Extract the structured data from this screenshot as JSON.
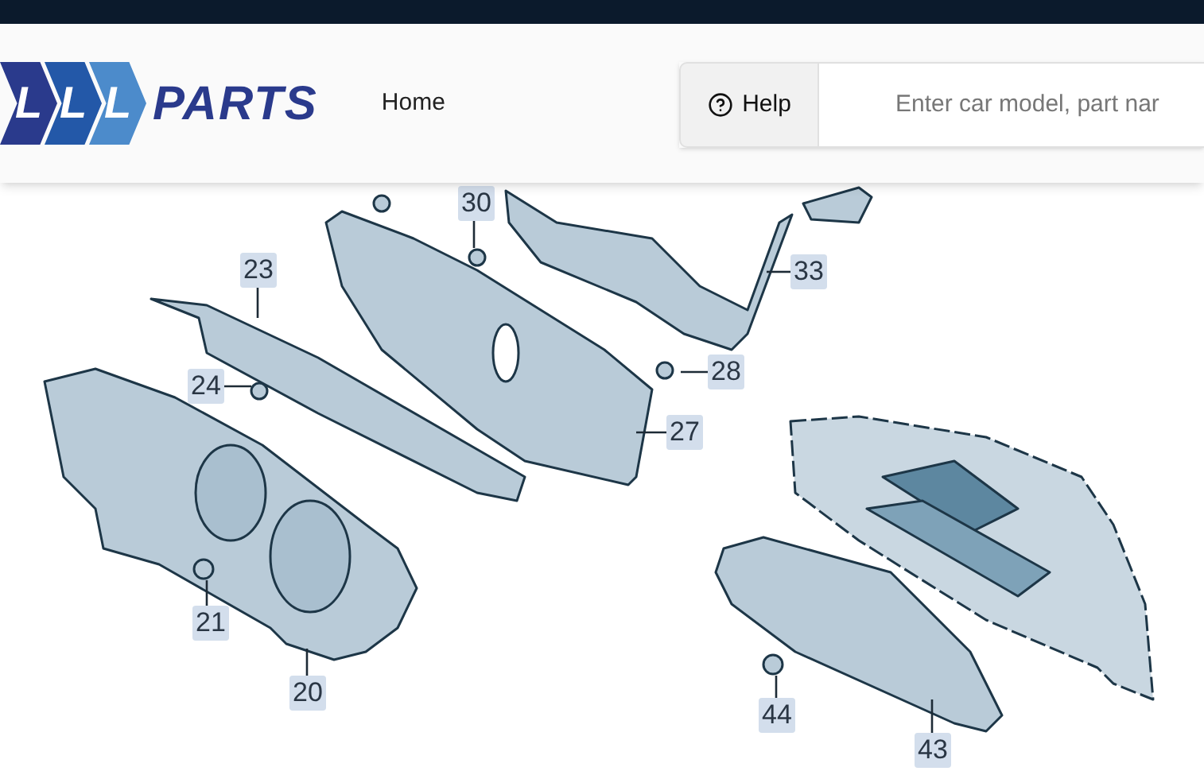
{
  "logo": {
    "letters": [
      "L",
      "L",
      "L"
    ],
    "word": "PARTS"
  },
  "nav": [
    {
      "label": "Home"
    }
  ],
  "help_button": {
    "label": "Help"
  },
  "search": {
    "placeholder": "Enter car model, part nar"
  },
  "diagram": {
    "callouts": [
      {
        "number": "30"
      },
      {
        "number": "23"
      },
      {
        "number": "33"
      },
      {
        "number": "24"
      },
      {
        "number": "28"
      },
      {
        "number": "27"
      },
      {
        "number": "21"
      },
      {
        "number": "20"
      },
      {
        "number": "44"
      },
      {
        "number": "43"
      }
    ]
  }
}
